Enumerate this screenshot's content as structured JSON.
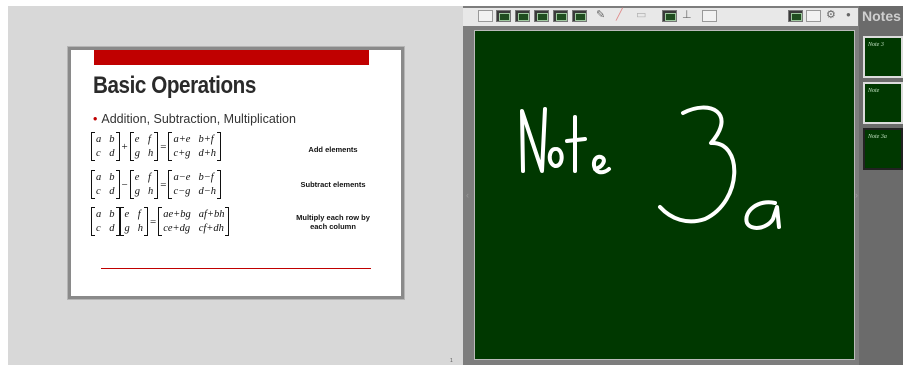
{
  "slide": {
    "title": "Basic Operations",
    "bullet": "Addition, Subtraction, Multiplication",
    "rows": [
      {
        "label": "Add elements",
        "m1": [
          "a",
          "b",
          "c",
          "d"
        ],
        "op": "+",
        "m2": [
          "e",
          "f",
          "g",
          "h"
        ],
        "result": [
          "a+e",
          "b+f",
          "c+g",
          "d+h"
        ]
      },
      {
        "label": "Subtract elements",
        "m1": [
          "a",
          "b",
          "c",
          "d"
        ],
        "op": "−",
        "m2": [
          "e",
          "f",
          "g",
          "h"
        ],
        "result": [
          "a−e",
          "b−f",
          "c−g",
          "d−h"
        ]
      },
      {
        "label": "Multiply each row by each column",
        "m1": [
          "a",
          "b",
          "c",
          "d"
        ],
        "op": "",
        "m2": [
          "e",
          "f",
          "g",
          "h"
        ],
        "result": [
          "ae+bg",
          "af+bh",
          "ce+dg",
          "cf+dh"
        ]
      }
    ],
    "equals": "="
  },
  "page_indicator": "1",
  "whiteboard": {
    "handwritten_text_1": "Note",
    "handwritten_text_2": "3a",
    "background_color": "#003800"
  },
  "notes_panel": {
    "header": "Notes",
    "thumbnails": [
      {
        "label": "Note 3"
      },
      {
        "label": "Note"
      },
      {
        "label": "Note 3a"
      }
    ]
  },
  "toolbar": {
    "icons": [
      "folder-icon",
      "slide-icon",
      "slide-icon",
      "slide-icon",
      "slide-icon",
      "slide-icon",
      "pen-icon",
      "highlighter-icon",
      "eraser-icon",
      "board-icon",
      "stand-icon",
      "image-icon",
      "board-icon",
      "grid-icon",
      "settings-icon",
      "close-icon"
    ]
  }
}
